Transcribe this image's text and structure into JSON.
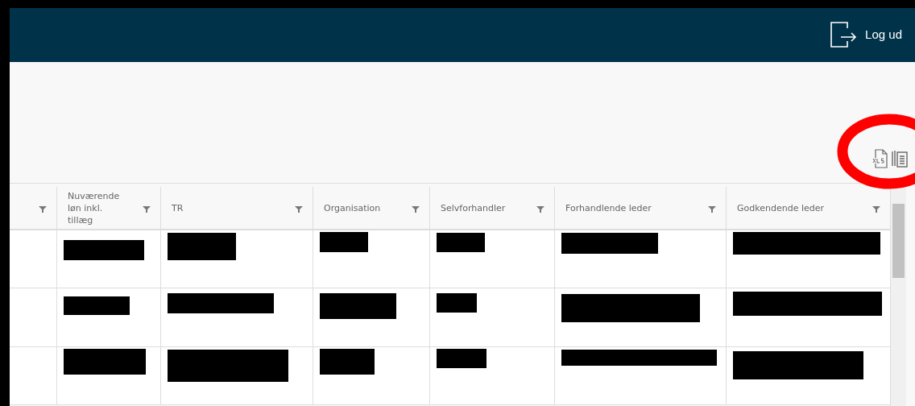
{
  "header": {
    "logout_label": "Log ud"
  },
  "toolbar": {
    "actions": [
      {
        "kind": "xls"
      },
      {
        "kind": "copy"
      }
    ]
  },
  "highlight": {
    "kind": "ring"
  },
  "table": {
    "columns": [
      {
        "kind": "filter"
      },
      {
        "label": "Nuværende løn inkl. tillæg",
        "kind": "filter"
      },
      {
        "label": "TR",
        "kind": "filter"
      },
      {
        "label": "Organisation",
        "kind": "filter"
      },
      {
        "label": "Selvforhandler",
        "kind": "filter"
      },
      {
        "label": "Forhandlende leder",
        "kind": "filter"
      },
      {
        "label": "Godkendende leder",
        "kind": "filter"
      }
    ],
    "rows": [
      {
        "cells": [
          {
            "kind": "empty"
          },
          {
            "kind": "redacted"
          },
          {
            "kind": "redacted"
          },
          {
            "kind": "redacted"
          },
          {
            "kind": "redacted"
          },
          {
            "kind": "redacted"
          },
          {
            "kind": "redacted"
          }
        ]
      },
      {
        "cells": [
          {
            "kind": "empty"
          },
          {
            "kind": "redacted"
          },
          {
            "kind": "redacted"
          },
          {
            "kind": "redacted"
          },
          {
            "kind": "redacted"
          },
          {
            "kind": "redacted"
          },
          {
            "kind": "redacted"
          }
        ]
      },
      {
        "cells": [
          {
            "kind": "empty"
          },
          {
            "kind": "redacted"
          },
          {
            "kind": "redacted"
          },
          {
            "kind": "redacted"
          },
          {
            "kind": "redacted"
          },
          {
            "kind": "redacted"
          },
          {
            "kind": "redacted"
          }
        ]
      }
    ]
  }
}
